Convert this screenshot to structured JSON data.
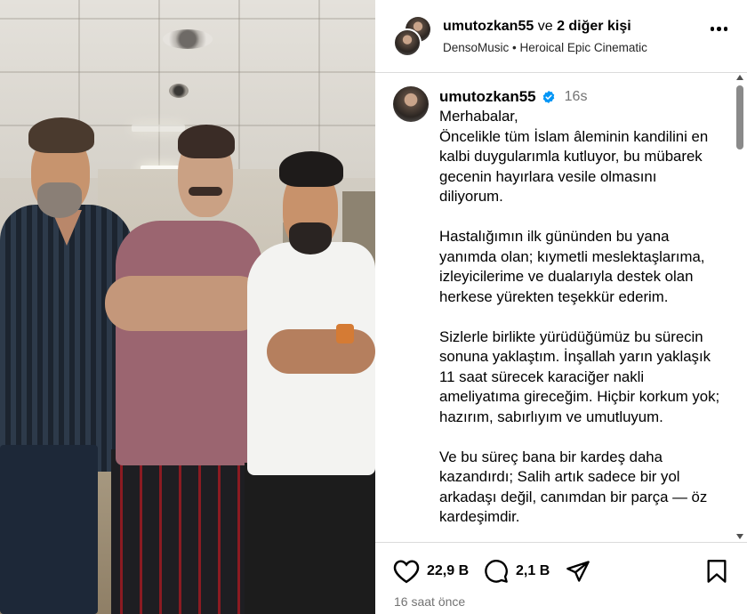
{
  "header": {
    "username": "umutozkan55",
    "joiner": "ve",
    "others": "2 diğer kişi",
    "audio_artist": "DensoMusic",
    "audio_separator": "•",
    "audio_track": "Heroical Epic Cinematic",
    "more_icon": "more-horizontal-icon"
  },
  "caption": {
    "username": "umutozkan55",
    "verified_icon": "verified-badge-icon",
    "time": "16s",
    "paragraphs": [
      "Merhabalar,\nÖncelikle tüm İslam âleminin kandilini en kalbi duygularımla kutluyor, bu mübarek gecenin hayırlara vesile olmasını diliyorum.",
      "Hastalığımın ilk gününden bu yana yanımda olan; kıymetli meslektaşlarıma, izleyicilerime ve dualarıyla destek olan herkese yürekten teşekkür ederim.",
      "Sizlerle birlikte yürüdüğümüz bu sürecin sonuna yaklaştım. İnşallah yarın yaklaşık 11 saat sürecek karaciğer nakli ameliyatıma gireceğim. Hiçbir korkum yok; hazırım, sabırlıyım ve umutluyum.",
      "Ve bu süreç bana bir kardeş daha kazandırdı; Salih artık sadece bir yol arkadaşı değil, canımdan bir parça — öz kardeşimdir."
    ]
  },
  "actions": {
    "likes": "22,9 B",
    "comments": "2,1 B",
    "like_icon": "heart-icon",
    "comment_icon": "comment-icon",
    "share_icon": "share-icon",
    "save_icon": "bookmark-icon"
  },
  "posted_ago": "16 saat önce"
}
